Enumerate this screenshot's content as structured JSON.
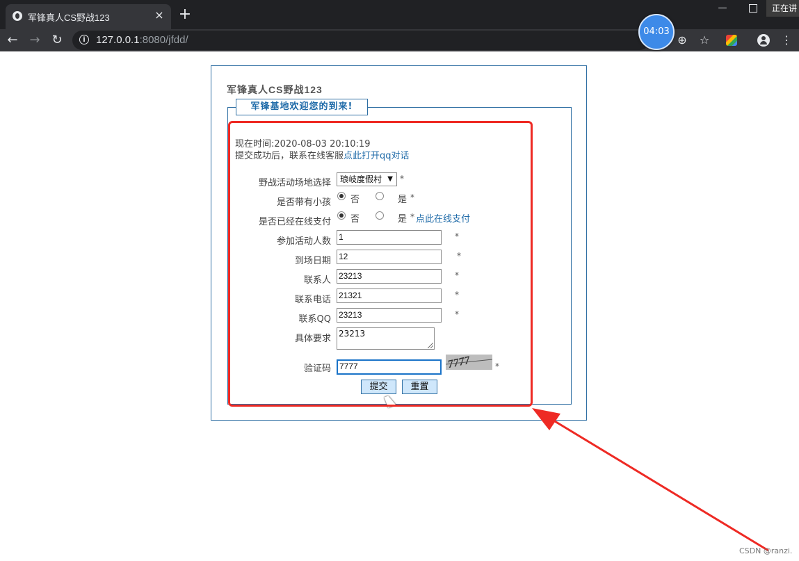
{
  "browser": {
    "tab_title": "军锋真人CS野战123",
    "tab_close": "×",
    "new_tab": "+",
    "url_host": "127.0.0.1",
    "url_rest": ":8080/jfdd/",
    "window_minimize": "—",
    "speaking_label": "正在讲",
    "timer": "04:03",
    "back_glyph": "←",
    "forward_glyph": "→",
    "reload_glyph": "↻",
    "info_glyph": "i",
    "zoom_glyph": "⊕",
    "star_glyph": "☆",
    "menu_glyph": "⋮"
  },
  "page": {
    "site_title": "军锋真人CS野战123",
    "legend": "军锋基地欢迎您的到来!",
    "current_time_label": "现在时间:",
    "current_time_value": "2020-08-03 20:10:19",
    "notice_text": "提交成功后，联系在线客服",
    "notice_link": "点此打开qq对话"
  },
  "form": {
    "venue": {
      "label": "野战活动场地选择",
      "value": "琅岐度假村",
      "arrow": "▼",
      "required": "*"
    },
    "children": {
      "label": "是否带有小孩",
      "opt_no": "否",
      "opt_yes": "是",
      "required": "*",
      "selected": "否"
    },
    "paid": {
      "label": "是否已经在线支付",
      "opt_no": "否",
      "opt_yes": "是",
      "required": "*",
      "pay_link": "点此在线支付",
      "selected": "否"
    },
    "people": {
      "label": "参加活动人数",
      "value": "1",
      "required": "*"
    },
    "date": {
      "label": "到场日期",
      "value": "12",
      "required": "*"
    },
    "contact": {
      "label": "联系人",
      "value": "23213",
      "required": "*"
    },
    "phone": {
      "label": "联系电话",
      "value": "21321",
      "required": "*"
    },
    "qq": {
      "label": "联系QQ",
      "value": "23213",
      "required": "*"
    },
    "requirements": {
      "label": "具体要求",
      "value": "23213"
    },
    "captcha": {
      "label": "验证码",
      "value": "7777",
      "required": "*"
    },
    "submit": "提交",
    "reset": "重置"
  },
  "annotation": {
    "color": "#ee2a24"
  },
  "watermark": "CSDN @ranzi."
}
